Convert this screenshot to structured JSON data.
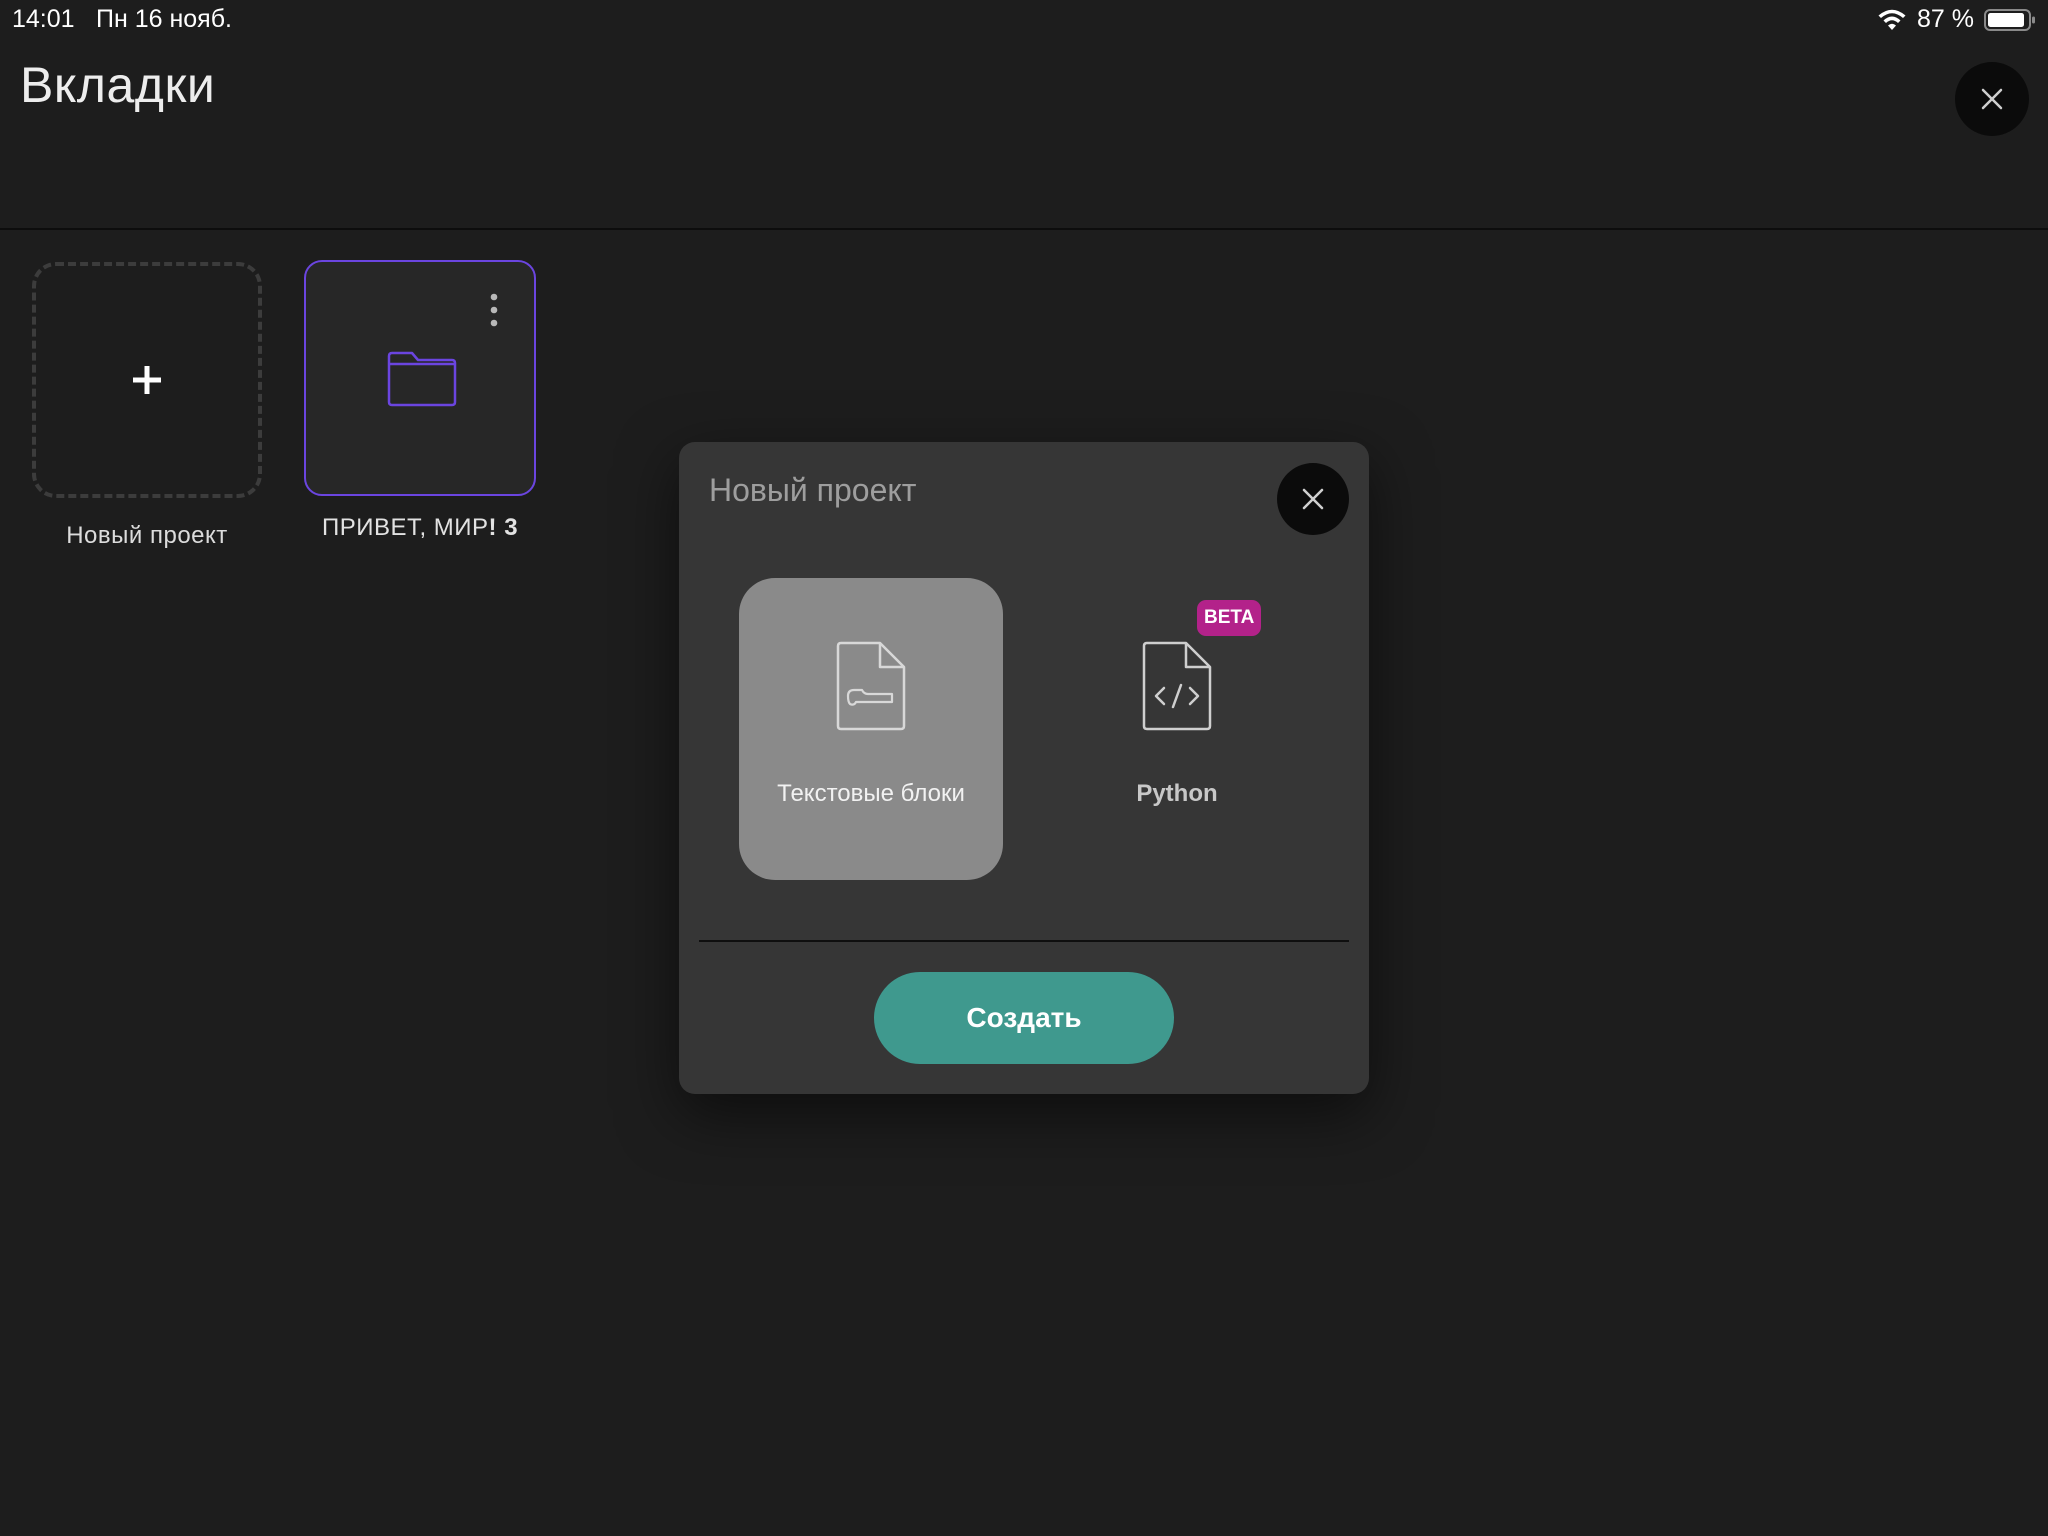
{
  "status_bar": {
    "time": "14:01",
    "date": "Пн 16 нояб.",
    "battery": "87 %"
  },
  "header": {
    "title": "Вкладки"
  },
  "tiles": {
    "new_project_label": "Новый проект",
    "project_name": "ПРИВЕТ, МИР",
    "project_suffix": "! 3",
    "project_accent_color": "#6b45e0"
  },
  "modal": {
    "title": "Новый проект",
    "options": [
      {
        "label": "Текстовые блоки",
        "icon": "text-blocks-doc-icon",
        "selected": true
      },
      {
        "label": "Python",
        "icon": "code-doc-icon",
        "badge": "BETA",
        "selected": false
      }
    ],
    "create_label": "Создать",
    "create_color": "#3f998e",
    "badge_color": "#b3228a"
  }
}
